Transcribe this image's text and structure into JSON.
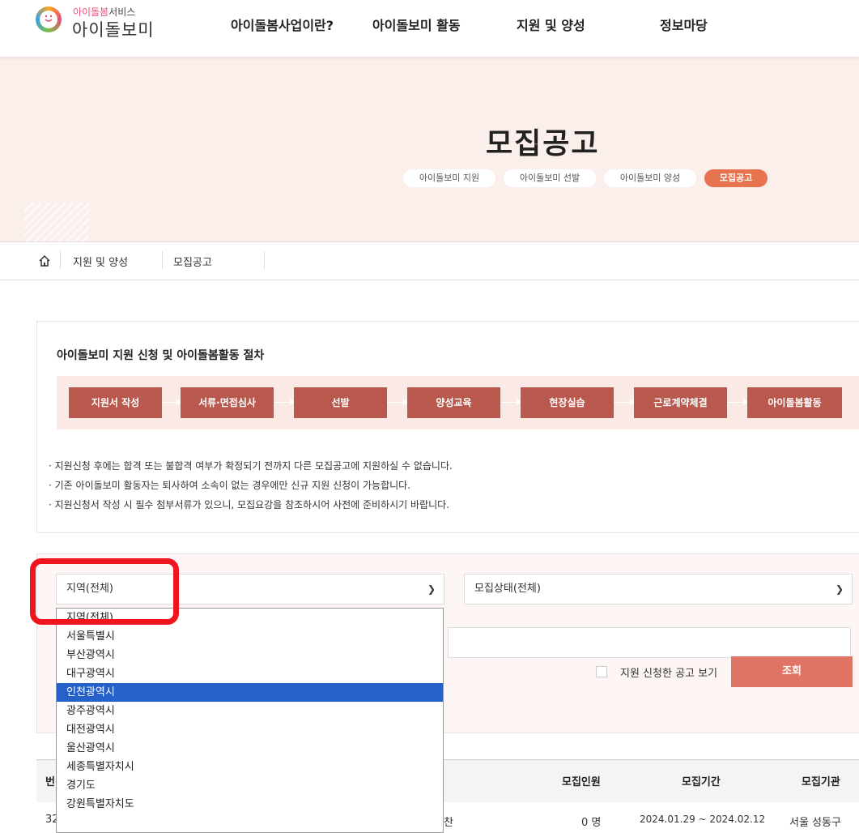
{
  "header": {
    "logo_sub_pink": "아이돌봄",
    "logo_sub_rest": "서비스",
    "logo_main": "아이돌보미",
    "nav": [
      "아이돌봄사업이란?",
      "아이돌보미 활동",
      "지원 및 양성",
      "정보마당"
    ]
  },
  "banner": {
    "title": "모집공고",
    "pills": [
      "아이돌보미 지원",
      "아이돌보미 선발",
      "아이돌보미 양성",
      "모집공고"
    ]
  },
  "breadcrumb": {
    "level1": "지원 및 양성",
    "level2": "모집공고"
  },
  "procedure": {
    "title": "아이돌보미 지원 신청 및 아이돌봄활동 절차",
    "steps": [
      "지원서 작성",
      "서류·면접심사",
      "선발",
      "양성교육",
      "현장실습",
      "근로계약체결",
      "아이돌봄활동"
    ],
    "notes": [
      "· 지원신청 후에는 합격 또는 불합격 여부가 확정되기 전까지 다른 모집공고에 지원하실 수 없습니다.",
      "· 기존 아이돌보미 활동자는 퇴사하여 소속이 없는 경우에만 신규 지원 신청이 가능합니다.",
      "· 지원신청서 작성 시 필수 첨부서류가 있으니, 모집요강을 참조하시어 사전에 준비하시기 바랍니다."
    ]
  },
  "search": {
    "region_value": "지역(전체)",
    "status_value": "모집상태(전체)",
    "region_options": [
      "지역(전체)",
      "서울특별시",
      "부산광역시",
      "대구광역시",
      "인천광역시",
      "광주광역시",
      "대전광역시",
      "울산광역시",
      "세종특별자치시",
      "경기도",
      "강원특별자치도"
    ],
    "highlighted_option": "인천광역시",
    "applied_checkbox_label": "지원 신청한 공고 보기",
    "search_button": "조회"
  },
  "table": {
    "headers": {
      "no": "번",
      "count": "모집인원",
      "period": "모집기간",
      "org": "모집기관"
    },
    "rows": [
      {
        "no": "32",
        "title_tail": "찬",
        "count": "0 명",
        "period": "2024.01.29 ~ 2024.02.12",
        "org": "서울 성동구"
      }
    ]
  },
  "colors": {
    "accent": "#e8734f",
    "step_bg": "#b9594e",
    "button_bg": "#e17565",
    "annotation": "#f0141e",
    "option_selected": "#2660c9"
  }
}
